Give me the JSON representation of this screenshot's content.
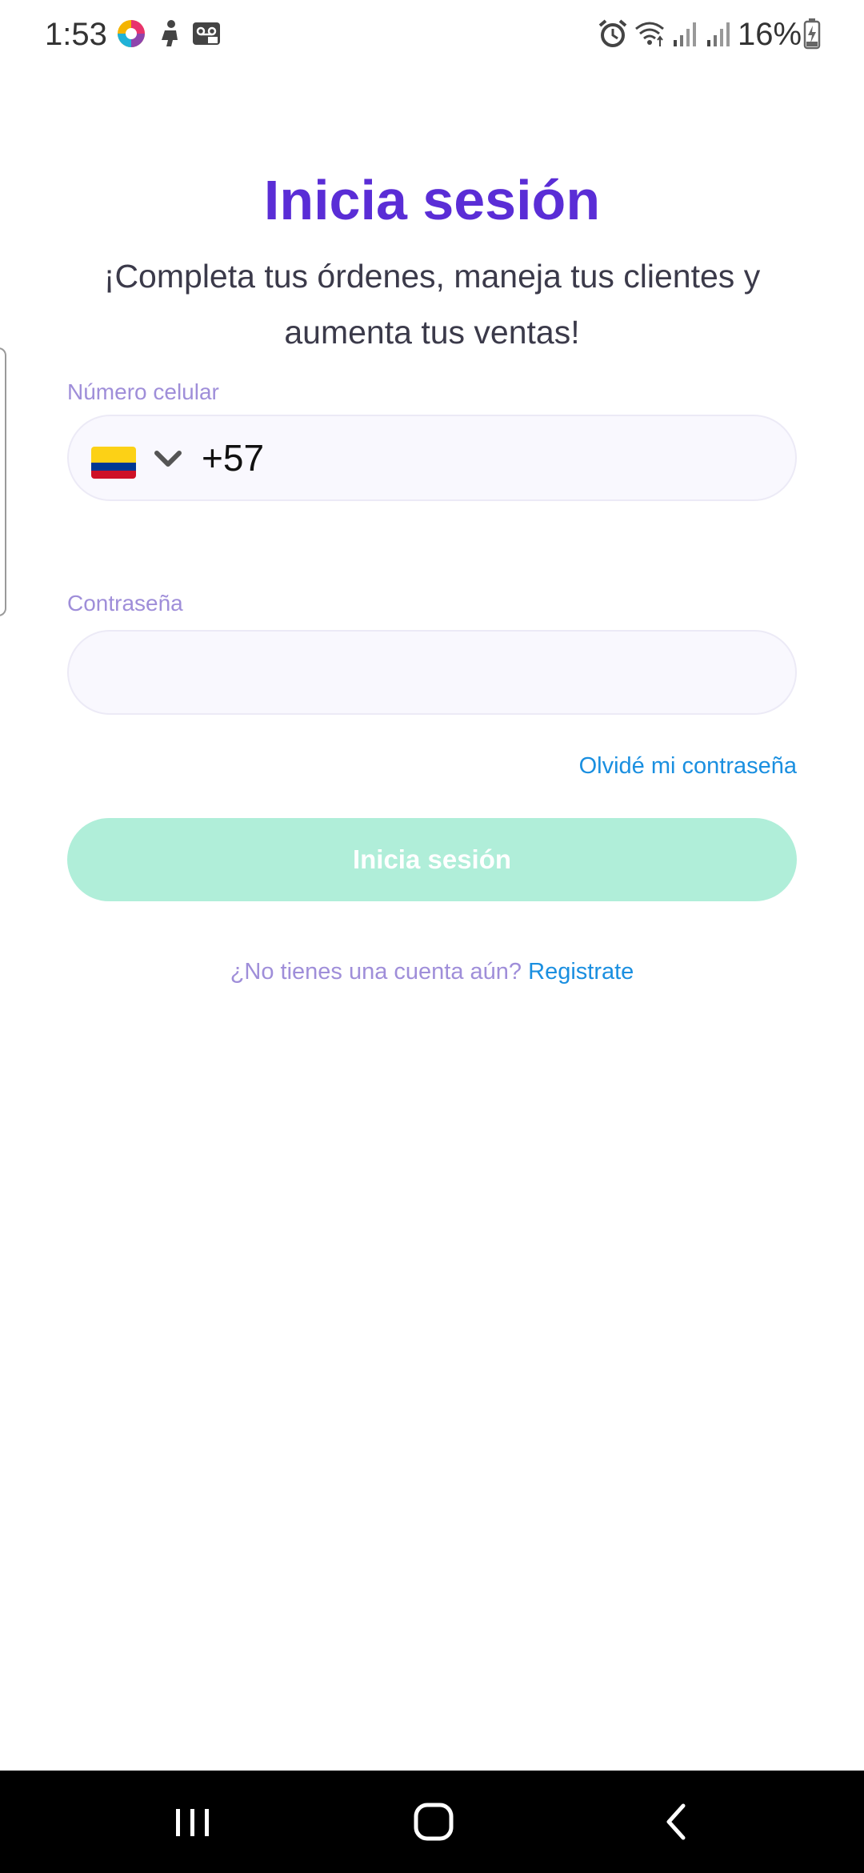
{
  "status_bar": {
    "time": "1:53",
    "battery": "16%",
    "icons": [
      "browser-app-icon",
      "figure-icon",
      "voicemail-icon",
      "alarm-icon",
      "wifi-icon",
      "signal-icon",
      "signal-icon",
      "battery-charging-icon"
    ]
  },
  "login": {
    "title": "Inicia sesión",
    "subtitle": "¡Completa tus órdenes, maneja tus clientes y aumenta tus ventas!",
    "phone": {
      "label": "Número celular",
      "country_flag": "colombia-flag",
      "dial_code": "+57",
      "value": ""
    },
    "password": {
      "label": "Contraseña",
      "value": ""
    },
    "forgot_password": "Olvidé mi contraseña",
    "submit_label": "Inicia sesión",
    "signup_prompt": "¿No tienes una cuenta aún?",
    "signup_link": "Registrate"
  },
  "nav_bar": {
    "buttons": [
      "recent-apps-icon",
      "home-icon",
      "back-icon"
    ]
  },
  "colors": {
    "title": "#5a2dd6",
    "label": "#9f8ed9",
    "link": "#1a8fe0",
    "button_disabled": "#b0eed9",
    "field_bg": "#f9f8fe"
  }
}
